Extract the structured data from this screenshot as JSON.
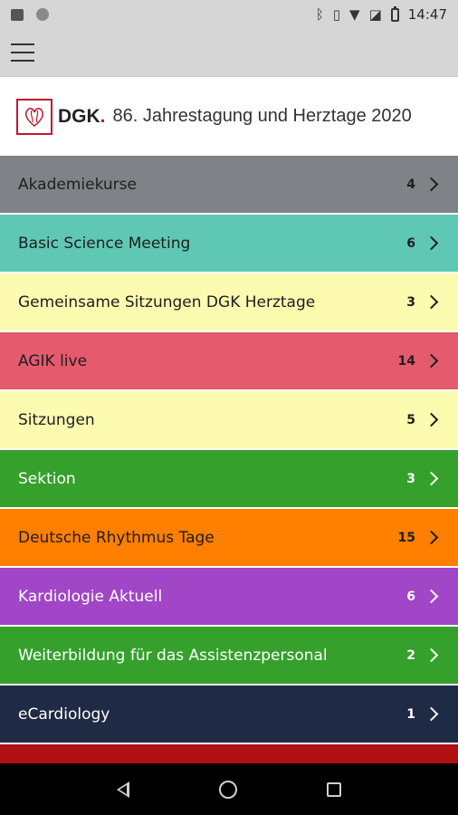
{
  "status_bar": {
    "time": "14:47",
    "icons": [
      "image-icon",
      "dot-icon",
      "bluetooth-icon",
      "vibrate-icon",
      "wifi-icon",
      "no-sim-icon",
      "battery-icon"
    ]
  },
  "header": {
    "brand": "DGK",
    "brand_dot": ".",
    "title": "86. Jahrestagung und Herztage 2020",
    "brand_color": "#c0182c"
  },
  "items": [
    {
      "label": "Akademiekurse",
      "count": "4",
      "bg": "#7f8387",
      "fg": "#1e1e1e"
    },
    {
      "label": "Basic Science Meeting",
      "count": "6",
      "bg": "#5fc8b5",
      "fg": "#1e1e1e"
    },
    {
      "label": "Gemeinsame Sitzungen DGK Herztage",
      "count": "3",
      "bg": "#fdfbb0",
      "fg": "#1e1e1e"
    },
    {
      "label": "AGIK live",
      "count": "14",
      "bg": "#e55a6d",
      "fg": "#1e1e1e"
    },
    {
      "label": "Sitzungen",
      "count": "5",
      "bg": "#fdfbb0",
      "fg": "#1e1e1e"
    },
    {
      "label": "Sektion",
      "count": "3",
      "bg": "#35a02b",
      "fg": "#ffffff"
    },
    {
      "label": "Deutsche Rhythmus Tage",
      "count": "15",
      "bg": "#ff7f00",
      "fg": "#1e1e1e"
    },
    {
      "label": "Kardiologie Aktuell",
      "count": "6",
      "bg": "#a046c6",
      "fg": "#ffffff"
    },
    {
      "label": "Weiterbildung für das Assistenzpersonal",
      "count": "2",
      "bg": "#35a02b",
      "fg": "#ffffff"
    },
    {
      "label": "eCardiology",
      "count": "1",
      "bg": "#1f2a44",
      "fg": "#ffffff"
    }
  ],
  "nav": [
    "back-icon",
    "home-icon",
    "recents-icon"
  ]
}
